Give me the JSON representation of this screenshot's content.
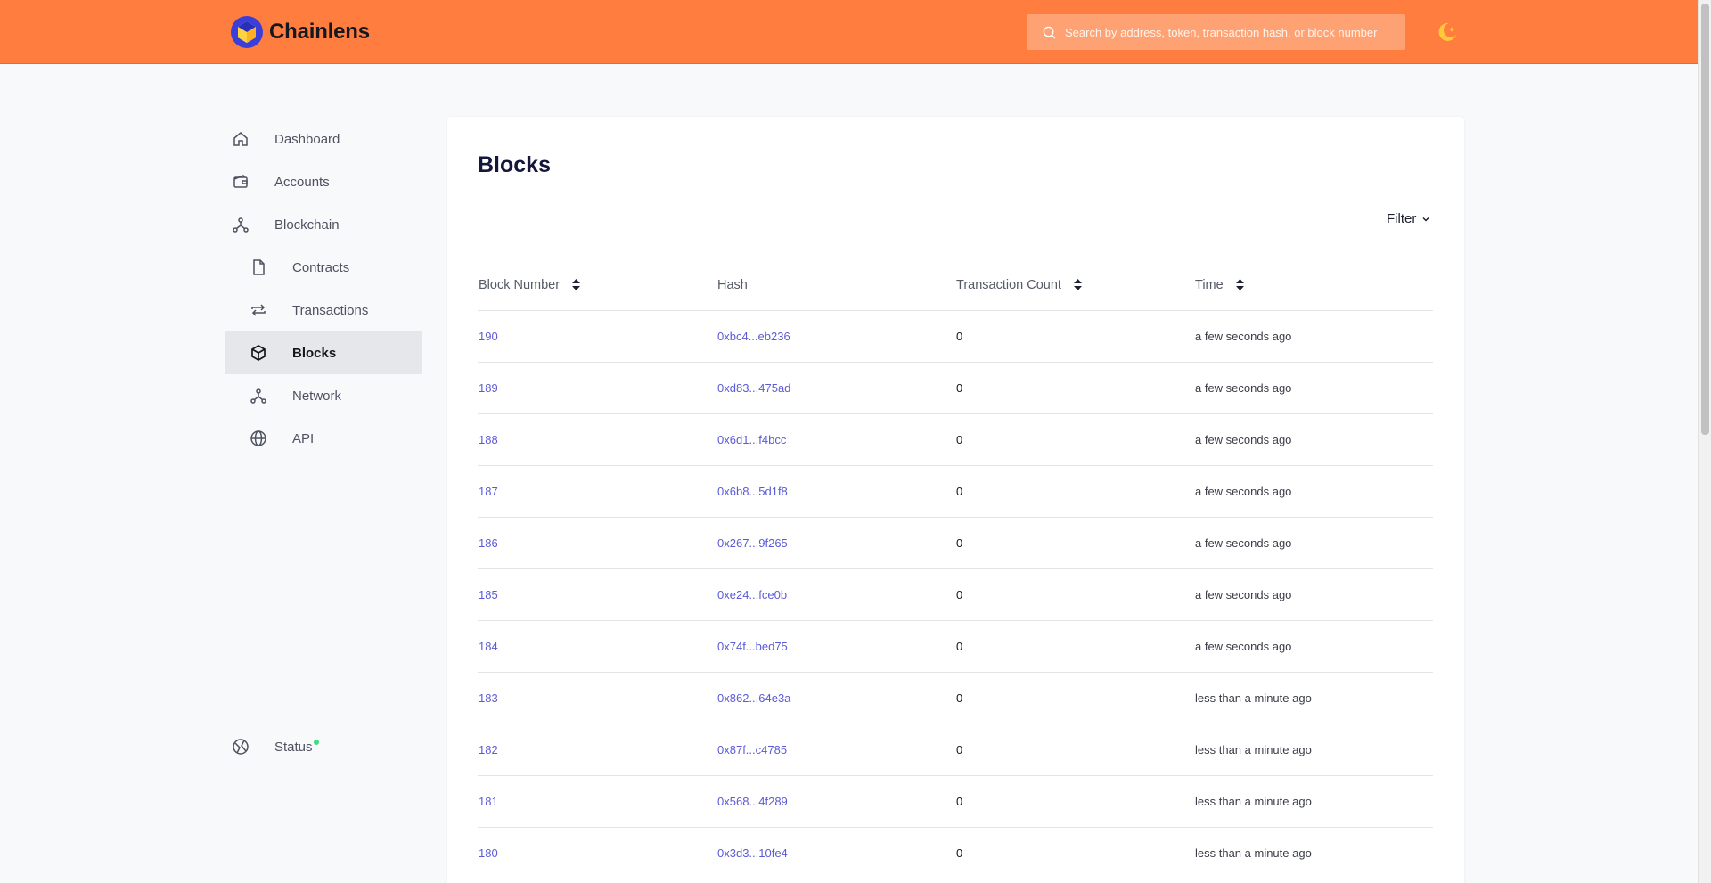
{
  "app": {
    "name": "Chainlens"
  },
  "search": {
    "placeholder": "Search by address, token, transaction hash, or block number"
  },
  "sidebar": {
    "items": [
      {
        "label": "Dashboard",
        "icon": "home-icon"
      },
      {
        "label": "Accounts",
        "icon": "wallet-icon"
      },
      {
        "label": "Blockchain",
        "icon": "blockchain-icon"
      },
      {
        "label": "Contracts",
        "icon": "file-icon"
      },
      {
        "label": "Transactions",
        "icon": "repeat-icon"
      },
      {
        "label": "Blocks",
        "icon": "cube-icon",
        "active": true
      },
      {
        "label": "Network",
        "icon": "network-icon"
      },
      {
        "label": "API",
        "icon": "globe-icon"
      }
    ],
    "status": {
      "label": "Status",
      "icon": "status-icon",
      "dot_color": "#3ddc84"
    }
  },
  "main": {
    "title": "Blocks",
    "filter_label": "Filter",
    "table": {
      "headers": [
        "Block Number",
        "Hash",
        "Transaction Count",
        "Time"
      ],
      "rows": [
        [
          "190",
          "0xbc4...eb236",
          "0",
          "a few seconds ago"
        ],
        [
          "189",
          "0xd83...475ad",
          "0",
          "a few seconds ago"
        ],
        [
          "188",
          "0x6d1...f4bcc",
          "0",
          "a few seconds ago"
        ],
        [
          "187",
          "0x6b8...5d1f8",
          "0",
          "a few seconds ago"
        ],
        [
          "186",
          "0x267...9f265",
          "0",
          "a few seconds ago"
        ],
        [
          "185",
          "0xe24...fce0b",
          "0",
          "a few seconds ago"
        ],
        [
          "184",
          "0x74f...bed75",
          "0",
          "a few seconds ago"
        ],
        [
          "183",
          "0x862...64e3a",
          "0",
          "less than a minute ago"
        ],
        [
          "182",
          "0x87f...c4785",
          "0",
          "less than a minute ago"
        ],
        [
          "181",
          "0x568...4f289",
          "0",
          "less than a minute ago"
        ],
        [
          "180",
          "0x3d3...10fe4",
          "0",
          "less than a minute ago"
        ]
      ]
    }
  },
  "colors": {
    "header": "#ff7d3f",
    "link": "#5b5bd6",
    "active_bg": "#e6e7ea"
  }
}
